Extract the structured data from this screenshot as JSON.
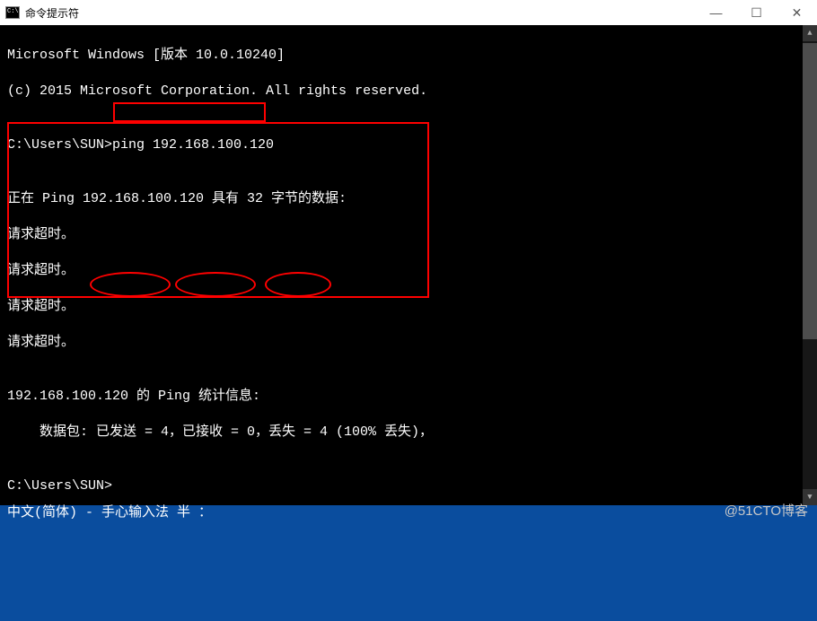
{
  "titlebar": {
    "title": "命令提示符"
  },
  "terminal": {
    "line1": "Microsoft Windows [版本 10.0.10240]",
    "line2": "(c) 2015 Microsoft Corporation. All rights reserved.",
    "blank": "",
    "prompt1_path": "C:\\Users\\SUN>",
    "prompt1_cmd": "ping 192.168.100.120",
    "ping_header": "正在 Ping 192.168.100.120 具有 32 字节的数据:",
    "timeout1": "请求超时。",
    "timeout2": "请求超时。",
    "timeout3": "请求超时。",
    "timeout4": "请求超时。",
    "stats_header": "192.168.100.120 的 Ping 统计信息:",
    "stats_line": "    数据包: 已发送 = 4，已接收 = 0，丢失 = 4 (100% 丢失)，",
    "prompt2": "C:\\Users\\SUN>"
  },
  "ime": {
    "text": "中文(简体) - 手心输入法 半 ："
  },
  "watermark": {
    "text": "@51CTO博客"
  },
  "annotation_color": "#ff0000"
}
